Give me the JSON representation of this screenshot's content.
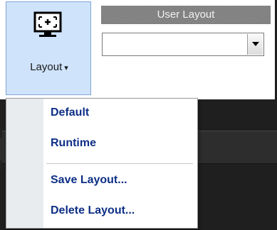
{
  "ribbon": {
    "layout_button": {
      "label": "Layout",
      "dropdown_arrow": "▾",
      "icon": "layout-monitor-icon"
    },
    "user_layout": {
      "header": "User Layout",
      "selected_value": ""
    }
  },
  "menu": {
    "items": [
      {
        "label": "Default"
      },
      {
        "label": "Runtime"
      },
      {
        "label": "Save Layout..."
      },
      {
        "label": "Delete Layout..."
      }
    ]
  },
  "colors": {
    "button_bg": "#cfe3fb",
    "button_border": "#7fa6d6",
    "menu_text": "#0e2f86",
    "header_bg": "#7f7f7f",
    "dark_area": "#1f1f1f"
  }
}
